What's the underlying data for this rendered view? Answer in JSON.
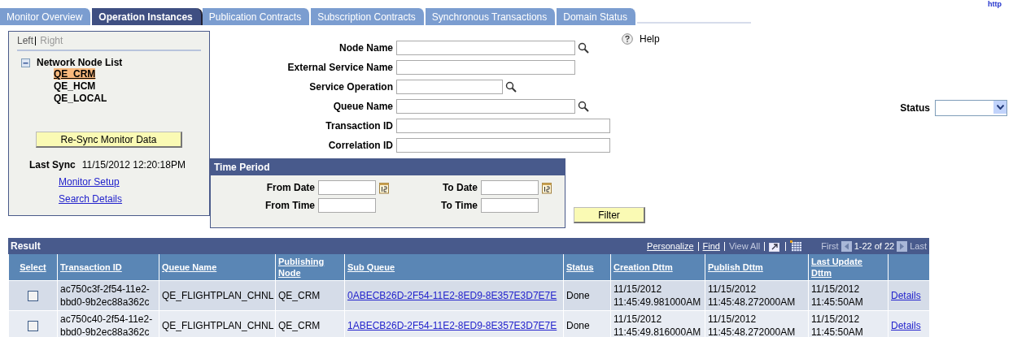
{
  "header_link": "http",
  "tabs": [
    {
      "label": "Monitor Overview",
      "selected": false
    },
    {
      "label": "Operation Instances",
      "selected": true
    },
    {
      "label": "Publication Contracts",
      "selected": false
    },
    {
      "label": "Subscription Contracts",
      "selected": false
    },
    {
      "label": "Synchronous Transactions",
      "selected": false
    },
    {
      "label": "Domain Status",
      "selected": false
    }
  ],
  "left_panel": {
    "layout_links": [
      {
        "label": "Left",
        "selected": true
      },
      {
        "label": "Right",
        "selected": false
      }
    ],
    "tree": {
      "label": "Network Node List",
      "expanded": true,
      "children": [
        {
          "label": "QE_CRM",
          "selected": true
        },
        {
          "label": "QE_HCM",
          "selected": false
        },
        {
          "label": "QE_LOCAL",
          "selected": false
        }
      ]
    },
    "resync_button": "Re-Sync Monitor Data",
    "last_sync_label": "Last Sync",
    "last_sync_value": "11/15/2012 12:20:18PM",
    "links": [
      "Monitor Setup",
      "Search Details"
    ]
  },
  "help": "Help",
  "fields": [
    {
      "label": "Node Name",
      "kind": "lookup"
    },
    {
      "label": "External Service Name",
      "kind": "text"
    },
    {
      "label": "Service Operation",
      "kind": "lookup"
    },
    {
      "label": "Queue Name",
      "kind": "lookup"
    },
    {
      "label": "Transaction ID",
      "kind": "text"
    },
    {
      "label": "Correlation ID",
      "kind": "text"
    }
  ],
  "status_filter": {
    "label": "Status"
  },
  "time_period": {
    "title": "Time Period",
    "fields": [
      {
        "label": "From Date",
        "kind": "date"
      },
      {
        "label": "To Date",
        "kind": "date"
      },
      {
        "label": "From Time",
        "kind": "time"
      },
      {
        "label": "To Time",
        "kind": "time"
      }
    ]
  },
  "filter_button": "Filter",
  "result": {
    "title": "Result",
    "toolbar": {
      "personalize": "Personalize",
      "find": "Find",
      "view_all": "View All",
      "first": "First",
      "range": "1-22 of 22",
      "last": "Last"
    },
    "columns": [
      "Select",
      "Transaction ID",
      "Queue Name",
      "Publishing Node",
      "Sub Queue",
      "Status",
      "Creation Dttm",
      "Publish Dttm",
      "Last Update Dttm"
    ],
    "rows": [
      {
        "selected": false,
        "transaction_id": "ac750c3f-2f54-11e2-bbd0-9b2ec88a362c",
        "queue_name": "QE_FLIGHTPLAN_CHNL",
        "publishing_node": "QE_CRM",
        "sub_queue": "0ABECB26D-2F54-11E2-8ED9-8E357E3D7E7E",
        "status": "Done",
        "creation": "11/15/2012 11:45:49.981000AM",
        "publish": "11/15/2012 11:45:48.272000AM",
        "last_update": "11/15/2012 11:45:50AM",
        "action": "Details"
      },
      {
        "selected": false,
        "transaction_id": "ac750c40-2f54-11e2-bbd0-9b2ec88a362c",
        "queue_name": "QE_FLIGHTPLAN_CHNL",
        "publishing_node": "QE_CRM",
        "sub_queue": "1ABECB26D-2F54-11E2-8ED9-8E357E3D7E7E",
        "status": "Done",
        "creation": "11/15/2012 11:45:49.816000AM",
        "publish": "11/15/2012 11:45:48.272000AM",
        "last_update": "11/15/2012 11:45:50AM",
        "action": "Details"
      }
    ]
  }
}
